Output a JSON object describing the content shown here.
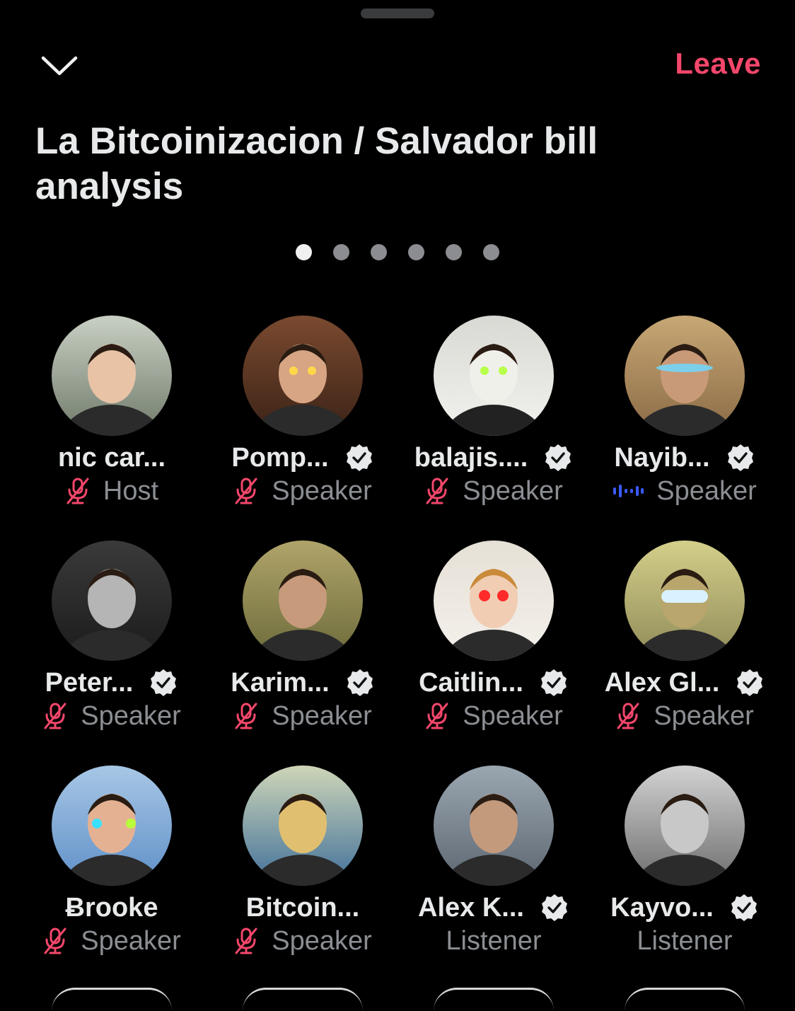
{
  "header": {
    "leave_label": "Leave",
    "title": "La Bitcoinizacion / Salvador bill analysis",
    "page_indicator": {
      "count": 6,
      "active": 1
    }
  },
  "colors": {
    "background": "#000000",
    "leave": "#f4476b",
    "muted_mic": "#f4476b",
    "speaking": "#3b5bff",
    "role_text": "#8b8e92"
  },
  "participants": [
    {
      "name": "nic car...",
      "role": "Host",
      "verified": false,
      "status": "muted"
    },
    {
      "name": "Pomp...",
      "role": "Speaker",
      "verified": true,
      "status": "muted"
    },
    {
      "name": "balajis....",
      "role": "Speaker",
      "verified": true,
      "status": "muted"
    },
    {
      "name": "Nayib...",
      "role": "Speaker",
      "verified": true,
      "status": "speaking"
    },
    {
      "name": "Peter...",
      "role": "Speaker",
      "verified": true,
      "status": "muted"
    },
    {
      "name": "Karim...",
      "role": "Speaker",
      "verified": true,
      "status": "muted"
    },
    {
      "name": "Caitlin...",
      "role": "Speaker",
      "verified": true,
      "status": "muted"
    },
    {
      "name": "Alex Gl...",
      "role": "Speaker",
      "verified": true,
      "status": "muted"
    },
    {
      "name": "Ƀrooke",
      "role": "Speaker",
      "verified": false,
      "status": "muted"
    },
    {
      "name": "Bitcoin...",
      "role": "Speaker",
      "verified": false,
      "status": "muted"
    },
    {
      "name": "Alex K...",
      "role": "Listener",
      "verified": true,
      "status": "none"
    },
    {
      "name": "Kayvo...",
      "role": "Listener",
      "verified": true,
      "status": "none"
    }
  ]
}
